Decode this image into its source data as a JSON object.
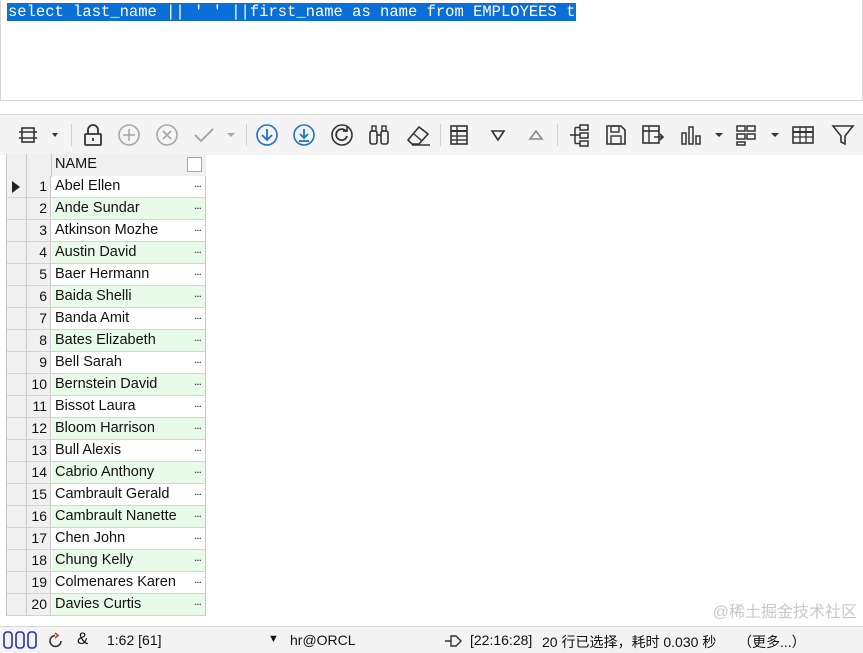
{
  "editor": {
    "sql": "select last_name || ' ' ||first_name as name from EMPLOYEES t"
  },
  "toolbar": {
    "icons": [
      "panels-icon",
      "lock-icon",
      "add-icon",
      "delete-icon",
      "confirm-icon",
      "fetch-next-icon",
      "fetch-all-icon",
      "refresh-icon",
      "find-icon",
      "clear-icon",
      "record-view-icon",
      "sort-desc-icon",
      "sort-asc-icon",
      "tree-icon",
      "save-icon",
      "export-icon",
      "chart-icon",
      "layout-icon",
      "grid-icon",
      "filter-icon"
    ]
  },
  "grid": {
    "column_header": "NAME",
    "cell_more": "...",
    "rows": [
      {
        "num": "1",
        "name": "Abel Ellen"
      },
      {
        "num": "2",
        "name": "Ande Sundar"
      },
      {
        "num": "3",
        "name": "Atkinson Mozhe"
      },
      {
        "num": "4",
        "name": "Austin David"
      },
      {
        "num": "5",
        "name": "Baer Hermann"
      },
      {
        "num": "6",
        "name": "Baida Shelli"
      },
      {
        "num": "7",
        "name": "Banda Amit"
      },
      {
        "num": "8",
        "name": "Bates Elizabeth"
      },
      {
        "num": "9",
        "name": "Bell Sarah"
      },
      {
        "num": "10",
        "name": "Bernstein David"
      },
      {
        "num": "11",
        "name": "Bissot Laura"
      },
      {
        "num": "12",
        "name": "Bloom Harrison"
      },
      {
        "num": "13",
        "name": "Bull Alexis"
      },
      {
        "num": "14",
        "name": "Cabrio Anthony"
      },
      {
        "num": "15",
        "name": "Cambrault Gerald"
      },
      {
        "num": "16",
        "name": "Cambrault Nanette"
      },
      {
        "num": "17",
        "name": "Chen John"
      },
      {
        "num": "18",
        "name": "Chung Kelly"
      },
      {
        "num": "19",
        "name": "Colmenares Karen"
      },
      {
        "num": "20",
        "name": "Davies Curtis"
      }
    ]
  },
  "status": {
    "cursor": "1:62 [61]",
    "connection": "hr@ORCL",
    "time": "[22:16:28]",
    "message": "20 行已选择，耗时 0.030 秒",
    "more": "（更多...）",
    "watermark": "@稀土掘金技术社区"
  },
  "colors": {
    "selection": "#0a6fd6",
    "even_row": "#e8fbe8",
    "icon_blue": "#1a73c8"
  }
}
